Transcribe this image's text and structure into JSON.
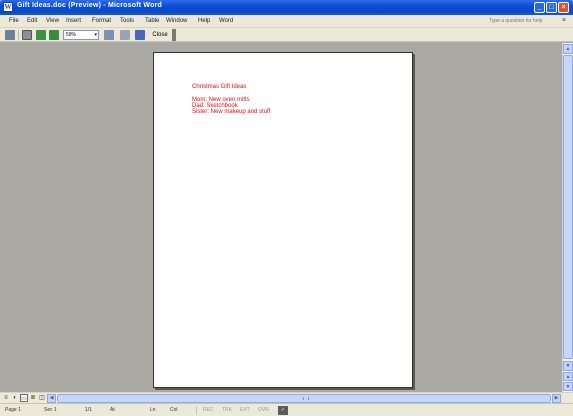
{
  "window": {
    "app_icon": "W",
    "title": "Gift Ideas.doc (Preview) - Microsoft Word",
    "minimize_icon": "minimize-icon",
    "maximize_icon": "maximize-icon",
    "close_icon": "close-icon"
  },
  "menu": {
    "items": [
      "File",
      "Edit",
      "View",
      "Insert",
      "Format",
      "Tools",
      "Table",
      "Window",
      "Help",
      "Word"
    ],
    "help_placeholder": "Type a question for help",
    "close_document_glyph": "×"
  },
  "toolbar": {
    "zoom": "59%",
    "close_label": "Close"
  },
  "document": {
    "lines": [
      "Christmas Gift Ideas",
      "",
      "Mom: New oven mitts",
      "Dad: Sketchbook",
      "Sister: New makeup and stuff"
    ],
    "text_color": "#dd1111"
  },
  "statusbar": {
    "page": "Page 1",
    "sec": "Sec 1",
    "page_of": "1/1",
    "at": "At",
    "ln": "Ln",
    "col": "Col",
    "rec": "REC",
    "trk": "TRK",
    "ext": "EXT",
    "ovr": "OVR"
  }
}
